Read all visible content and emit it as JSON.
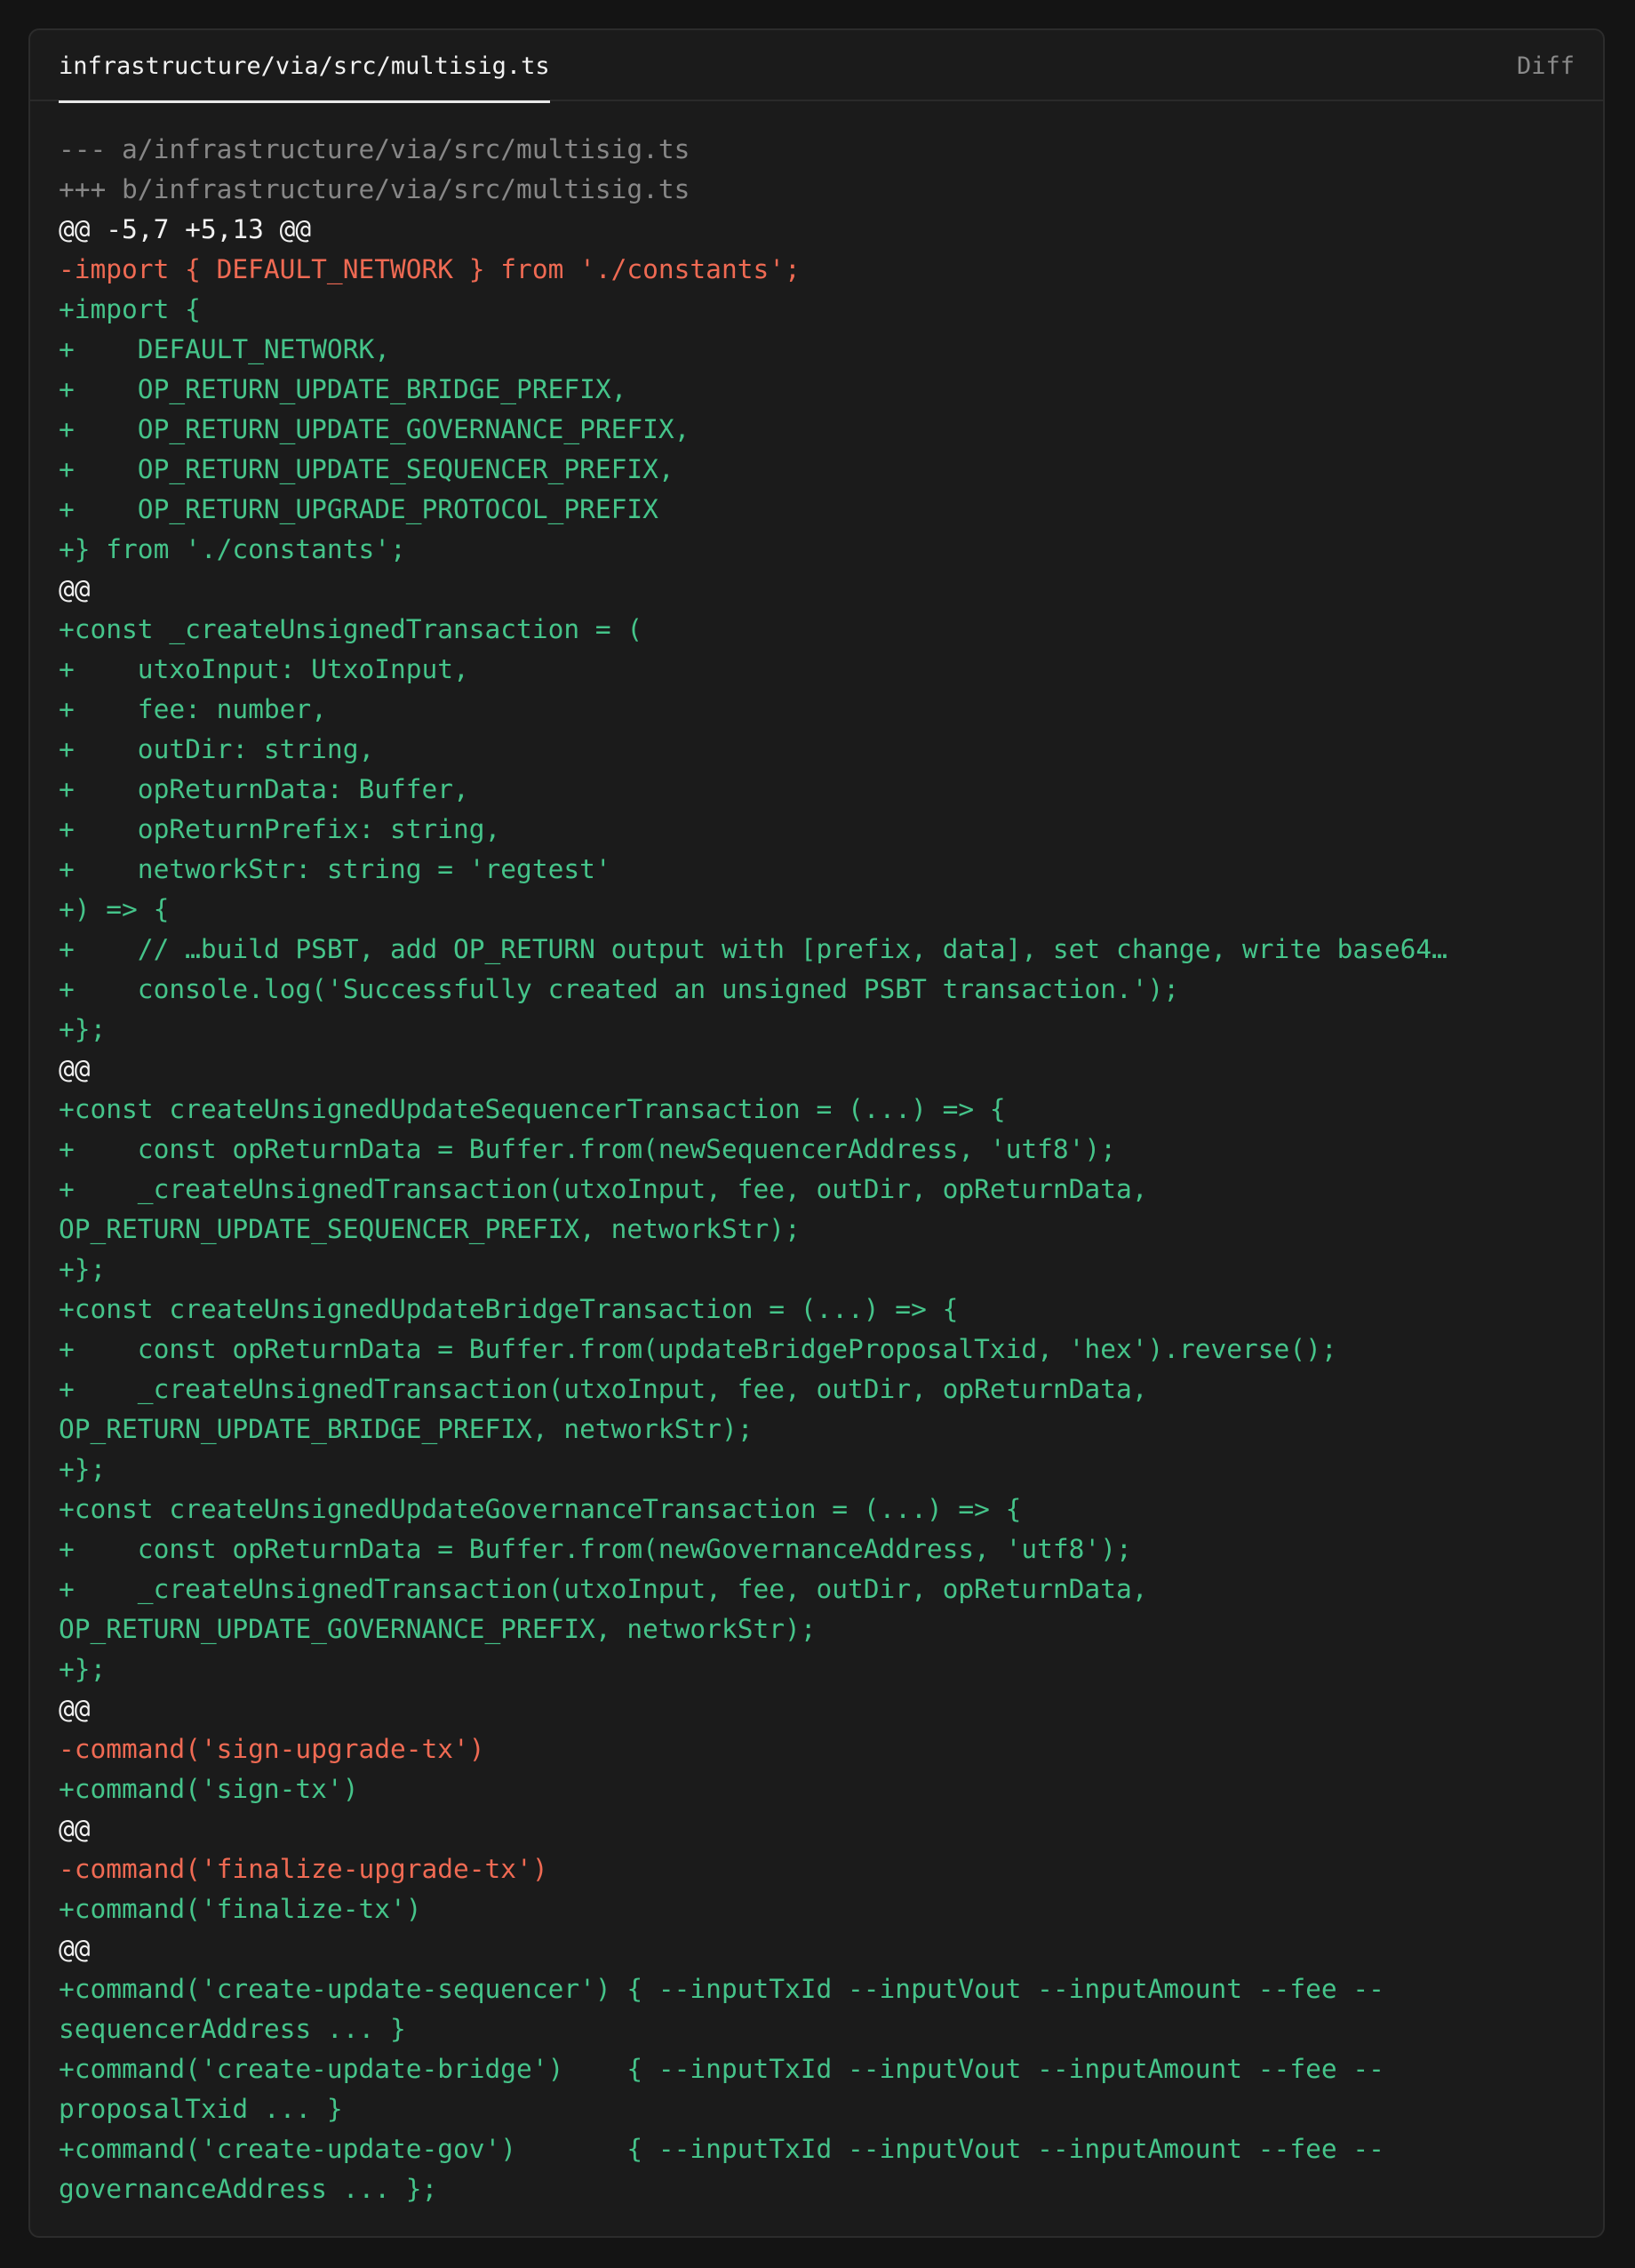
{
  "file_tab": {
    "label": "infrastructure/via/src/multisig.ts"
  },
  "view_label": "Diff",
  "colors": {
    "added": "#45c48a",
    "removed": "#ef6a53",
    "meta": "#878787",
    "hunk": "#f0f0f0",
    "background": "#1b1b1b"
  },
  "diff_lines": [
    {
      "kind": "meta",
      "text": "--- a/infrastructure/via/src/multisig.ts"
    },
    {
      "kind": "meta",
      "text": "+++ b/infrastructure/via/src/multisig.ts"
    },
    {
      "kind": "hunk",
      "text": "@@ -5,7 +5,13 @@"
    },
    {
      "kind": "del",
      "text": "-import { DEFAULT_NETWORK } from './constants';"
    },
    {
      "kind": "add",
      "text": "+import {"
    },
    {
      "kind": "add",
      "text": "+    DEFAULT_NETWORK,"
    },
    {
      "kind": "add",
      "text": "+    OP_RETURN_UPDATE_BRIDGE_PREFIX,"
    },
    {
      "kind": "add",
      "text": "+    OP_RETURN_UPDATE_GOVERNANCE_PREFIX,"
    },
    {
      "kind": "add",
      "text": "+    OP_RETURN_UPDATE_SEQUENCER_PREFIX,"
    },
    {
      "kind": "add",
      "text": "+    OP_RETURN_UPGRADE_PROTOCOL_PREFIX"
    },
    {
      "kind": "add",
      "text": "+} from './constants';"
    },
    {
      "kind": "hunk",
      "text": "@@"
    },
    {
      "kind": "add",
      "text": "+const _createUnsignedTransaction = ("
    },
    {
      "kind": "add",
      "text": "+    utxoInput: UtxoInput,"
    },
    {
      "kind": "add",
      "text": "+    fee: number,"
    },
    {
      "kind": "add",
      "text": "+    outDir: string,"
    },
    {
      "kind": "add",
      "text": "+    opReturnData: Buffer,"
    },
    {
      "kind": "add",
      "text": "+    opReturnPrefix: string,"
    },
    {
      "kind": "add",
      "text": "+    networkStr: string = 'regtest'"
    },
    {
      "kind": "add",
      "text": "+) => {"
    },
    {
      "kind": "add",
      "text": "+    // …build PSBT, add OP_RETURN output with [prefix, data], set change, write base64…"
    },
    {
      "kind": "add",
      "text": "+    console.log('Successfully created an unsigned PSBT transaction.');"
    },
    {
      "kind": "add",
      "text": "+};"
    },
    {
      "kind": "hunk",
      "text": "@@"
    },
    {
      "kind": "add",
      "text": "+const createUnsignedUpdateSequencerTransaction = (...) => {"
    },
    {
      "kind": "add",
      "text": "+    const opReturnData = Buffer.from(newSequencerAddress, 'utf8');"
    },
    {
      "kind": "add",
      "text": "+    _createUnsignedTransaction(utxoInput, fee, outDir, opReturnData,"
    },
    {
      "kind": "add",
      "text": "OP_RETURN_UPDATE_SEQUENCER_PREFIX, networkStr);"
    },
    {
      "kind": "add",
      "text": "+};"
    },
    {
      "kind": "add",
      "text": "+const createUnsignedUpdateBridgeTransaction = (...) => {"
    },
    {
      "kind": "add",
      "text": "+    const opReturnData = Buffer.from(updateBridgeProposalTxid, 'hex').reverse();"
    },
    {
      "kind": "add",
      "text": "+    _createUnsignedTransaction(utxoInput, fee, outDir, opReturnData,"
    },
    {
      "kind": "add",
      "text": "OP_RETURN_UPDATE_BRIDGE_PREFIX, networkStr);"
    },
    {
      "kind": "add",
      "text": "+};"
    },
    {
      "kind": "add",
      "text": "+const createUnsignedUpdateGovernanceTransaction = (...) => {"
    },
    {
      "kind": "add",
      "text": "+    const opReturnData = Buffer.from(newGovernanceAddress, 'utf8');"
    },
    {
      "kind": "add",
      "text": "+    _createUnsignedTransaction(utxoInput, fee, outDir, opReturnData,"
    },
    {
      "kind": "add",
      "text": "OP_RETURN_UPDATE_GOVERNANCE_PREFIX, networkStr);"
    },
    {
      "kind": "add",
      "text": "+};"
    },
    {
      "kind": "hunk",
      "text": "@@"
    },
    {
      "kind": "del",
      "text": "-command('sign-upgrade-tx')"
    },
    {
      "kind": "add",
      "text": "+command('sign-tx')"
    },
    {
      "kind": "hunk",
      "text": "@@"
    },
    {
      "kind": "del",
      "text": "-command('finalize-upgrade-tx')"
    },
    {
      "kind": "add",
      "text": "+command('finalize-tx')"
    },
    {
      "kind": "hunk",
      "text": "@@"
    },
    {
      "kind": "add",
      "text": "+command('create-update-sequencer') { --inputTxId --inputVout --inputAmount --fee --"
    },
    {
      "kind": "add",
      "text": "sequencerAddress ... }"
    },
    {
      "kind": "add",
      "text": "+command('create-update-bridge')    { --inputTxId --inputVout --inputAmount --fee --"
    },
    {
      "kind": "add",
      "text": "proposalTxid ... }"
    },
    {
      "kind": "add",
      "text": "+command('create-update-gov')       { --inputTxId --inputVout --inputAmount --fee --"
    },
    {
      "kind": "add",
      "text": "governanceAddress ... };"
    }
  ]
}
